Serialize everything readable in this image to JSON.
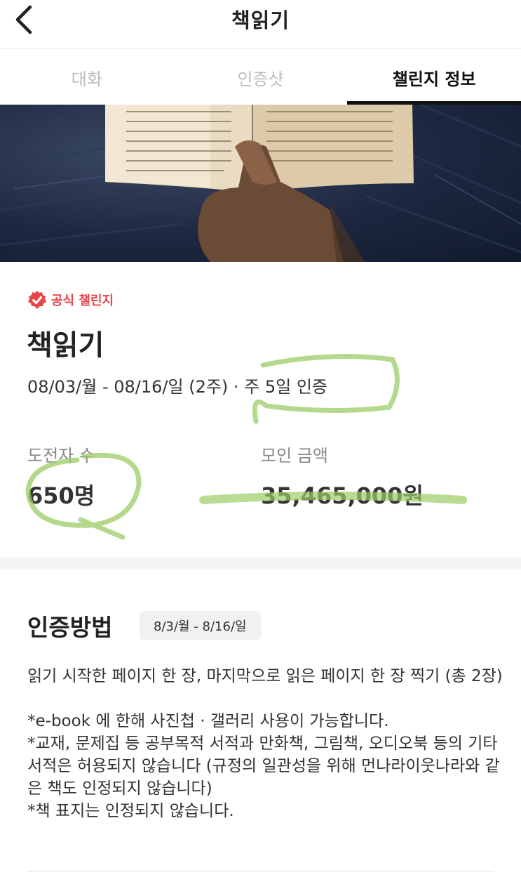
{
  "header": {
    "title": "책읽기",
    "back_icon": "chevron-left-icon"
  },
  "tabs": [
    {
      "label": "대화",
      "active": false
    },
    {
      "label": "인증샷",
      "active": false
    },
    {
      "label": "챌린지 정보",
      "active": true
    }
  ],
  "hero": {
    "description_icon": "book-photo"
  },
  "challenge": {
    "badge_label": "공식 챌린지",
    "badge_color": "#e7474a",
    "title": "책읽기",
    "period": "08/03/월 - 08/16/일 (2주) · 주 5일 인증",
    "participants_label": "도전자 수",
    "participants_value": "650명",
    "amount_label": "모인 금액",
    "amount_value": "35,465,000원"
  },
  "method": {
    "title": "인증방법",
    "date_chip": "8/3/월 - 8/16/일",
    "line1": "읽기 시작한 페이지 한 장, 마지막으로 읽은 페이지 한 장 찍기 (총 2장)",
    "note1": "*e-book 에 한해 사진첩 · 갤러리 사용이 가능합니다.",
    "note2": "*교재, 문제집 등 공부목적 서적과 만화책, 그림책, 오디오북 등의 기타서적은 허용되지 않습니다 (규정의 일관성을 위해 먼나라이웃나라와 같은 책도 인정되지 않습니다)",
    "note3": "*책 표지는 인정되지 않습니다."
  },
  "highlight_color": "#9ccc65"
}
